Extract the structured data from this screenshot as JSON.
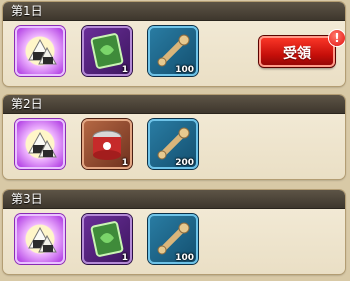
{
  "days": [
    {
      "label": "第1日",
      "items": [
        {
          "name": "rice-ball",
          "qty": ""
        },
        {
          "name": "ticket",
          "qty": "1"
        },
        {
          "name": "bone-key",
          "qty": "100"
        }
      ],
      "claim_label": "受領",
      "badge": "!"
    },
    {
      "label": "第2日",
      "items": [
        {
          "name": "rice-ball",
          "qty": ""
        },
        {
          "name": "pet-food-can",
          "qty": "1"
        },
        {
          "name": "bone-key",
          "qty": "200"
        }
      ]
    },
    {
      "label": "第3日",
      "items": [
        {
          "name": "rice-ball",
          "qty": ""
        },
        {
          "name": "ticket",
          "qty": "1"
        },
        {
          "name": "bone-key",
          "qty": "100"
        }
      ]
    }
  ]
}
